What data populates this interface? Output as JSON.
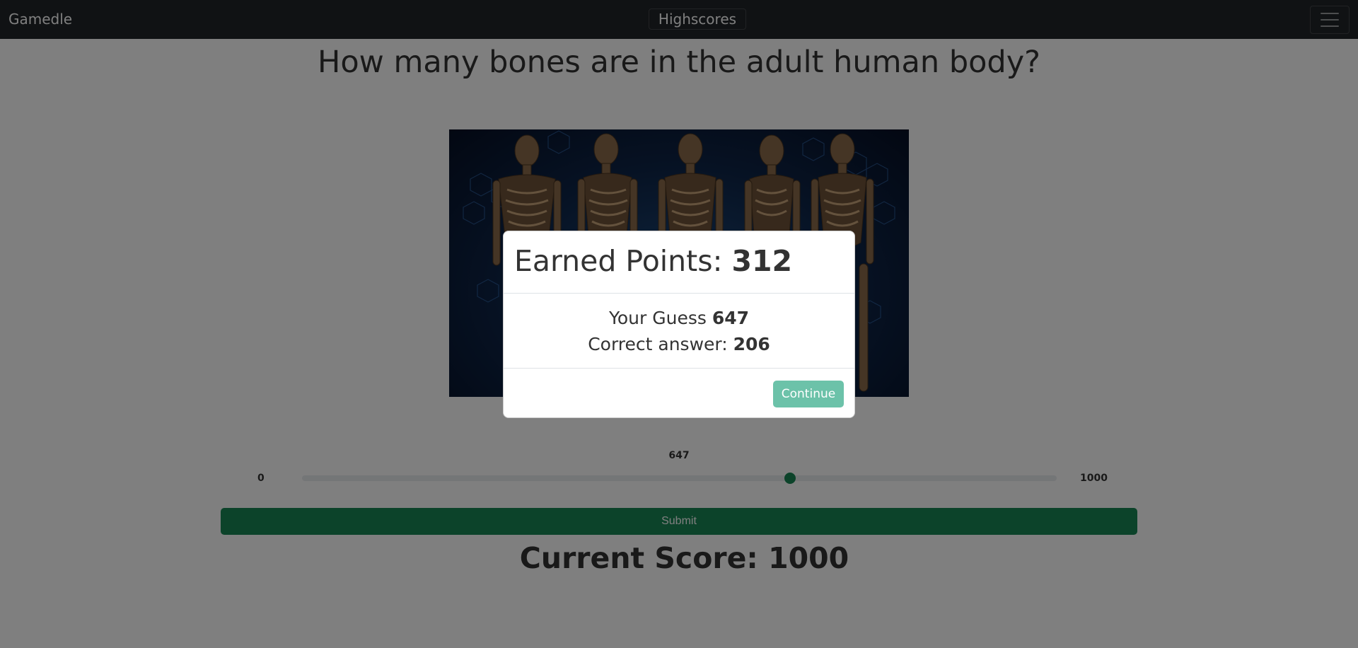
{
  "navbar": {
    "brand": "Gamedle",
    "highscores_label": "Highscores",
    "menu_icon": "hamburger-menu-icon"
  },
  "question": {
    "text": "How many bones are in the adult human body?",
    "image_icon": "skeletons-image"
  },
  "slider": {
    "min_label": "0",
    "max_label": "1000",
    "value_label": "647",
    "value": 647,
    "min": 0,
    "max": 1000
  },
  "submit": {
    "label": "Submit"
  },
  "score": {
    "label": "Current Score: 1000"
  },
  "modal": {
    "title_prefix": "Earned Points: ",
    "earned_points": "312",
    "guess_prefix": "Your Guess ",
    "guess_value": "647",
    "answer_prefix": "Correct answer: ",
    "answer_value": "206",
    "continue_label": "Continue"
  },
  "colors": {
    "navbar_bg": "#212529",
    "accent_green": "#198754",
    "continue_button": "#6cc2a9"
  }
}
